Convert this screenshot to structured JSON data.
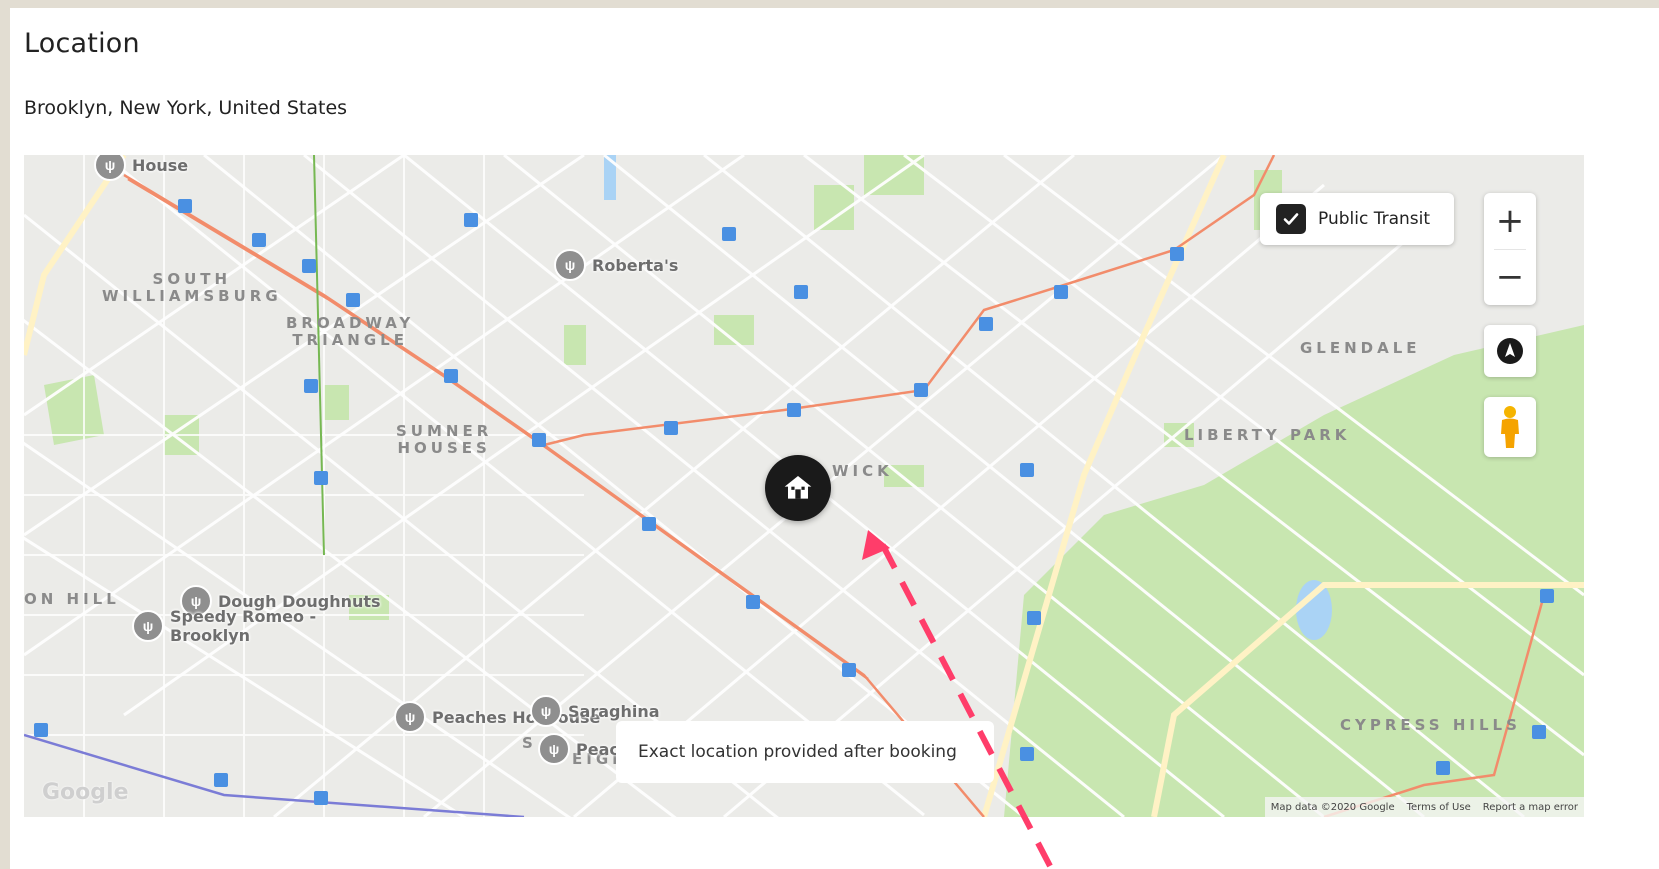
{
  "section": {
    "title": "Location",
    "address": "Brooklyn, New York, United States"
  },
  "map": {
    "areas": [
      {
        "text": "SOUTH\nWILLIAMSBURG"
      },
      {
        "text": "BROADWAY\nTRIANGLE"
      },
      {
        "text": "SUMNER\nHOUSES"
      },
      {
        "text": "WICK"
      },
      {
        "text": "GLENDALE"
      },
      {
        "text": "LIBERTY PARK"
      },
      {
        "text": "CYPRESS HILLS"
      },
      {
        "text": "ON HILL"
      },
      {
        "text": "S"
      },
      {
        "text": "EIGH"
      }
    ],
    "pois": [
      {
        "label": "House"
      },
      {
        "label": "Roberta's"
      },
      {
        "label": "Dough Doughnuts"
      },
      {
        "label": "Speedy Romeo -\nBrooklyn"
      },
      {
        "label": "Peaches HotHouse"
      },
      {
        "label": "Saraghina"
      },
      {
        "label": "Peaches"
      }
    ],
    "transit_toggle": {
      "label": "Public Transit",
      "checked": true
    },
    "zoom_in_label": "+",
    "zoom_out_label": "−",
    "note": "Exact location provided after booking",
    "google_logo": "Google",
    "attribution": {
      "data": "Map data ©2020 Google",
      "terms": "Terms of Use",
      "report": "Report a map error"
    },
    "icons": {
      "home_marker": "home-icon",
      "locate": "location-icon",
      "pegman": "street-view-pegman-icon",
      "poi": "restaurant-icon"
    },
    "colors": {
      "park": "#c8e6b0",
      "street": "#ffffff",
      "subway_line": "#f28c6b",
      "marker": "#1a1a1a",
      "annotation_arrow": "#ff3d6a"
    }
  }
}
